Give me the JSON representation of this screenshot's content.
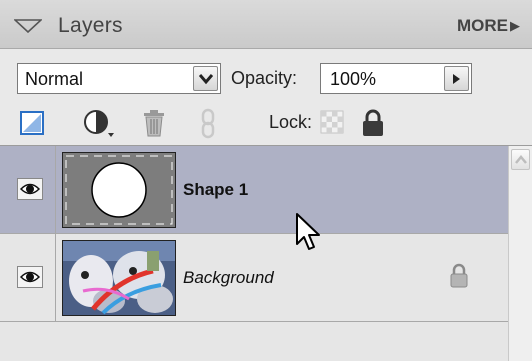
{
  "panel": {
    "title": "Layers",
    "more_label": "MORE",
    "icons": {
      "collapse": "triangle-down-icon",
      "more": "play-arrow-icon"
    }
  },
  "options": {
    "blend_mode": "Normal",
    "opacity_label": "Opacity:",
    "opacity_value": "100%",
    "lock_label": "Lock:",
    "tools": [
      "new-layer-icon",
      "adjustment-layer-icon",
      "trash-icon",
      "link-icon",
      "lock-transparent-icon",
      "lock-all-icon"
    ]
  },
  "layers": [
    {
      "name": "Shape 1",
      "selected": true,
      "visible": true,
      "bold": true,
      "italic": false,
      "locked": false
    },
    {
      "name": "Background",
      "selected": false,
      "visible": true,
      "bold": false,
      "italic": true,
      "locked": true
    }
  ],
  "colors": {
    "selected_row": "#aeb1c5",
    "panel_bg": "#e6e6e6",
    "header_bg": "#cfcfcf"
  }
}
